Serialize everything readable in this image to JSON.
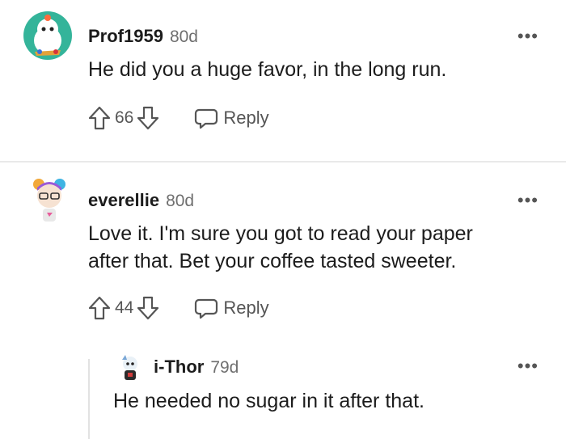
{
  "comments": [
    {
      "username": "Prof1959",
      "age": "80d",
      "body": "He did you a huge favor, in the long run.",
      "score": "66",
      "reply_label": "Reply",
      "more_label": "•••"
    },
    {
      "username": "everellie",
      "age": "80d",
      "body_lines": [
        "Love it. I'm sure you got to read your paper",
        "after that. Bet your coffee tasted sweeter."
      ],
      "score": "44",
      "reply_label": "Reply",
      "more_label": "•••"
    },
    {
      "username": "i-Thor",
      "age": "79d",
      "body": "He needed no sugar in it after that.",
      "more_label": "•••"
    }
  ],
  "colors": {
    "text": "#1c1c1c",
    "muted": "#6f6f6f",
    "divider": "#e9e9e9"
  },
  "icons": [
    "upvote-icon",
    "downvote-icon",
    "reply-bubble-icon",
    "more-options-icon"
  ]
}
